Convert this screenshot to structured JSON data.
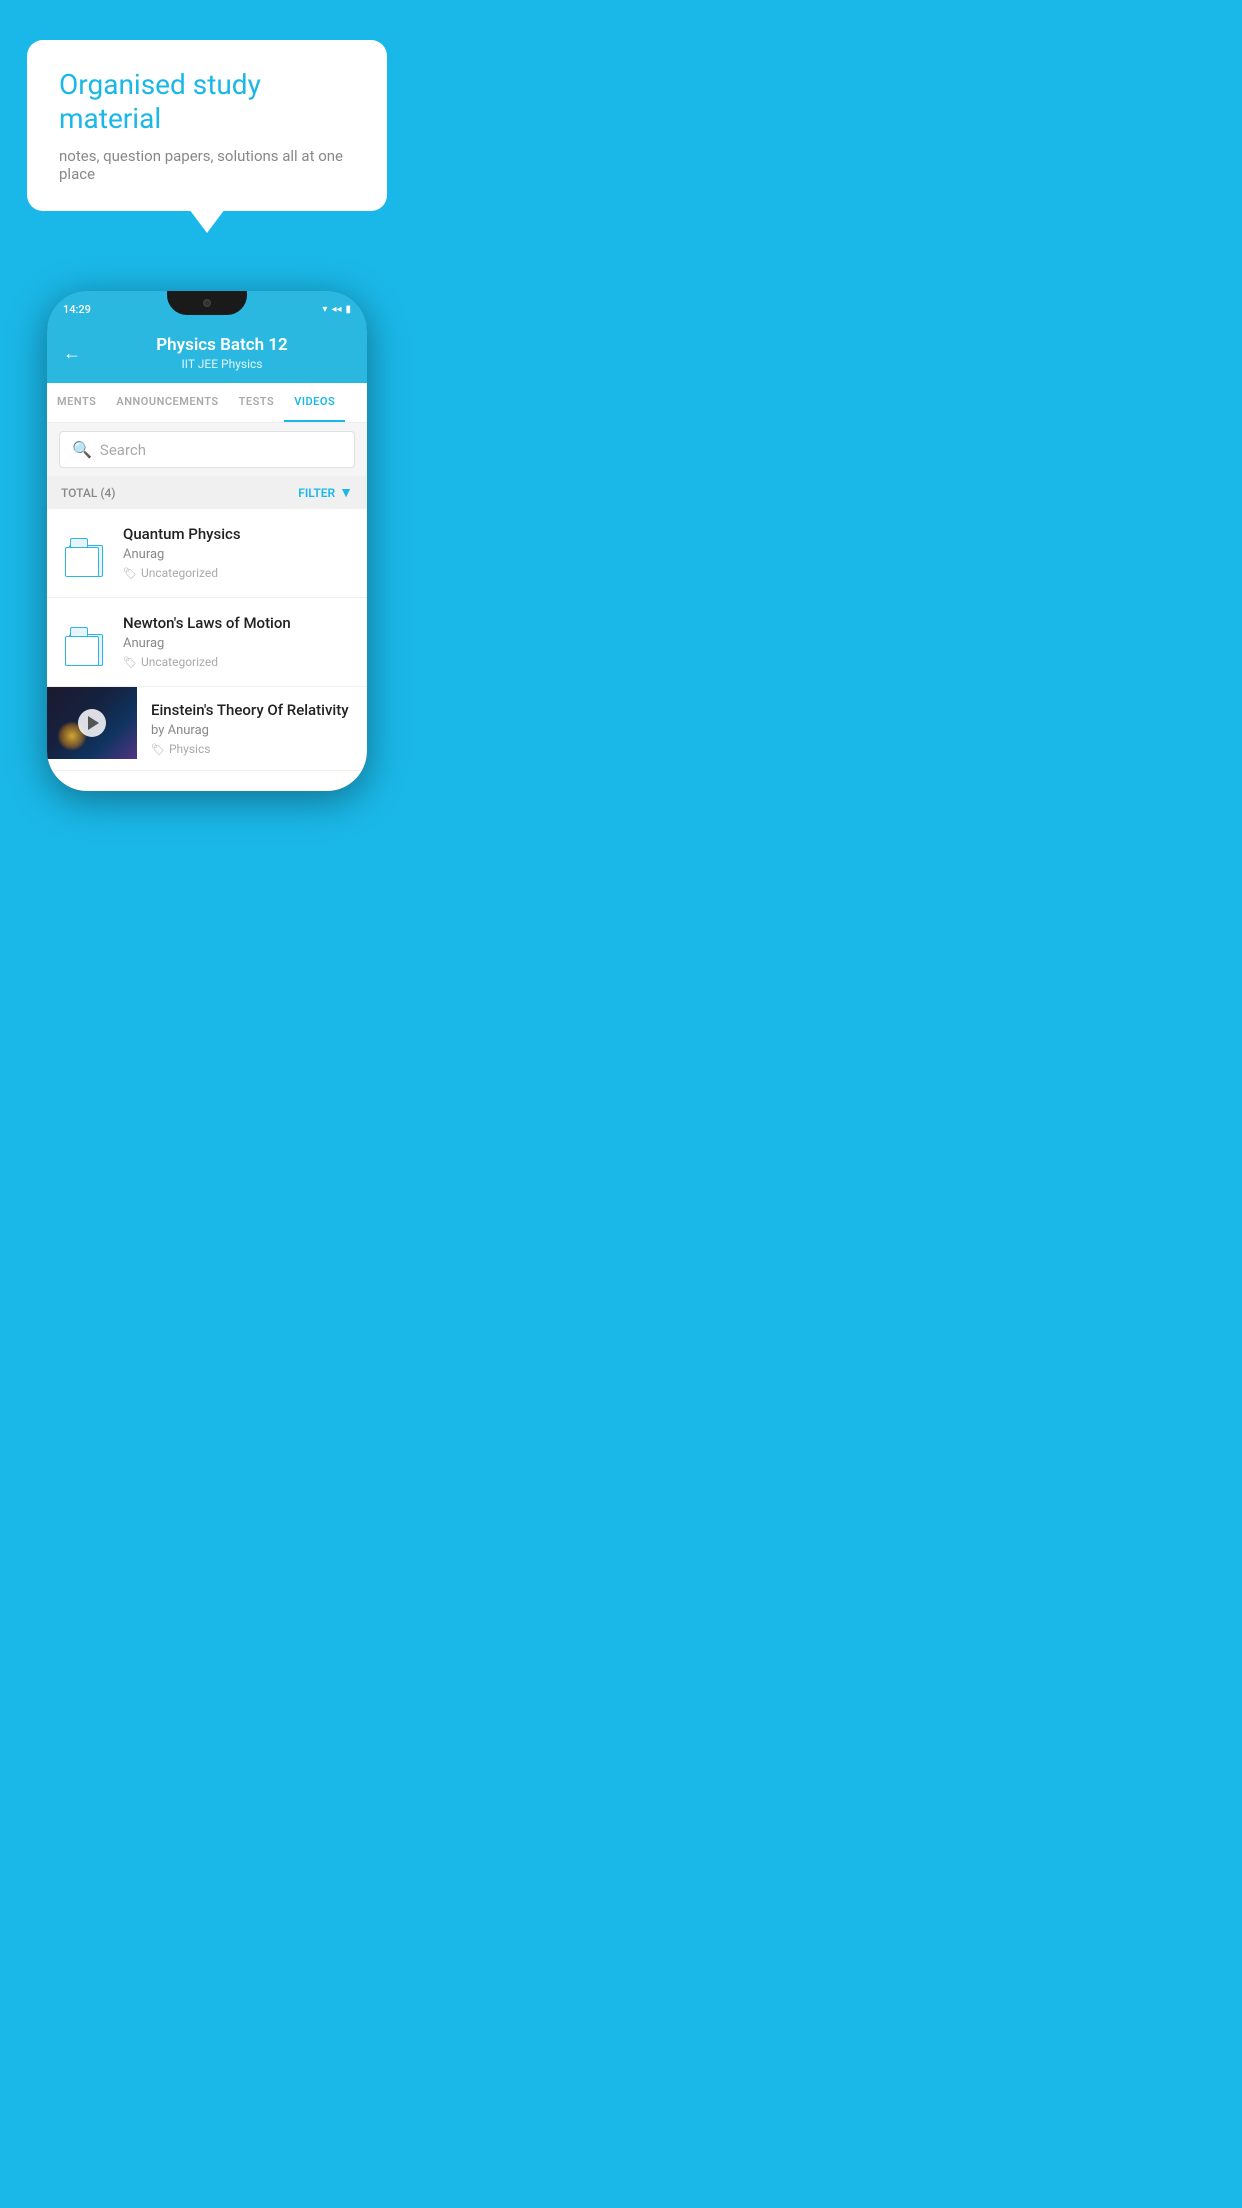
{
  "background_color": "#1ab8e8",
  "promo": {
    "bubble_title": "Organised study material",
    "bubble_subtitle": "notes, question papers, solutions all at one place"
  },
  "phone": {
    "status_time": "14:29",
    "header": {
      "title": "Physics Batch 12",
      "subtitle_tags": "IIT JEE   Physics",
      "back_label": "←"
    },
    "tabs": [
      {
        "label": "MENTS",
        "active": false
      },
      {
        "label": "ANNOUNCEMENTS",
        "active": false
      },
      {
        "label": "TESTS",
        "active": false
      },
      {
        "label": "VIDEOS",
        "active": true
      }
    ],
    "search": {
      "placeholder": "Search"
    },
    "filter_bar": {
      "total_label": "TOTAL (4)",
      "filter_label": "FILTER"
    },
    "items": [
      {
        "title": "Quantum Physics",
        "author": "Anurag",
        "tag": "Uncategorized",
        "type": "folder",
        "has_thumbnail": false
      },
      {
        "title": "Newton's Laws of Motion",
        "author": "Anurag",
        "tag": "Uncategorized",
        "type": "folder",
        "has_thumbnail": false
      },
      {
        "title": "Einstein's Theory Of Relativity",
        "author": "by Anurag",
        "tag": "Physics",
        "type": "video",
        "has_thumbnail": true
      }
    ]
  }
}
